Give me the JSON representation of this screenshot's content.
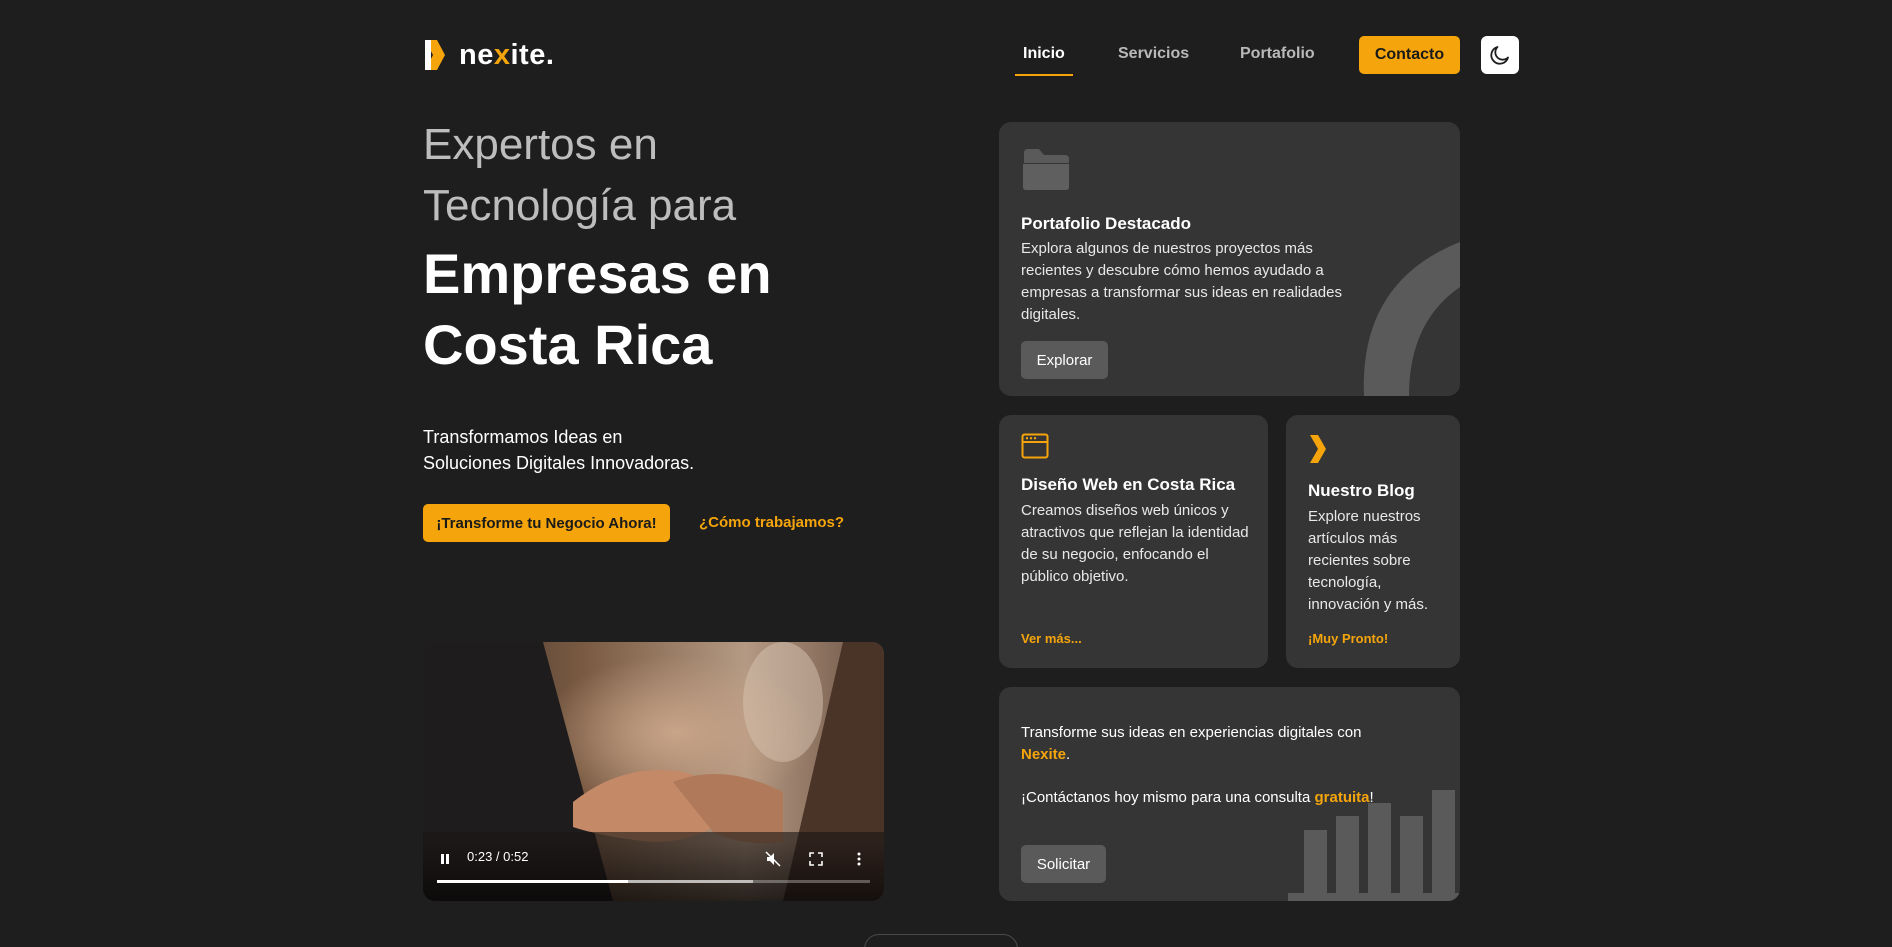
{
  "brand": {
    "name_prefix": "ne",
    "name_x": "x",
    "name_suffix": "ite.",
    "accent": "#f5a50b"
  },
  "nav": {
    "items": [
      {
        "label": "Inicio",
        "active": true
      },
      {
        "label": "Servicios",
        "active": false
      },
      {
        "label": "Portafolio",
        "active": false
      }
    ],
    "contact_label": "Contacto",
    "theme_icon": "moon-icon"
  },
  "hero": {
    "heading_line1": "Expertos en",
    "heading_line2": "Tecnología para",
    "heading_bold_line1": "Empresas en",
    "heading_bold_line2": "Costa Rica",
    "subtitle_line1": "Transformamos Ideas en",
    "subtitle_line2": "Soluciones Digitales Innovadoras.",
    "cta_primary": "¡Transforme tu Negocio Ahora!",
    "cta_secondary": "¿Cómo trabajamos?"
  },
  "video": {
    "time": "0:23 / 0:52",
    "played_fraction": 0.44,
    "buffered_fraction": 0.73,
    "state": "playing",
    "muted": true
  },
  "cards": {
    "portfolio": {
      "icon": "folder-icon",
      "title": "Portafolio Destacado",
      "text": "Explora algunos de nuestros proyectos más recientes y descubre cómo hemos ayudado a empresas a transformar sus ideas en realidades digitales.",
      "button": "Explorar"
    },
    "web": {
      "icon": "browser-window-icon",
      "title": "Diseño Web en Costa Rica",
      "text": "Creamos diseños web únicos y atractivos que reflejan la identidad de su negocio, enfocando el público objetivo.",
      "link": "Ver más..."
    },
    "blog": {
      "icon": "chevron-right-icon",
      "title": "Nuestro Blog",
      "text": "Explore nuestros artículos más recientes sobre tecnología, innovación y más.",
      "link": "¡Muy Pronto!"
    },
    "cta": {
      "text1": "Transforme sus ideas en experiencias digitales con",
      "brand": "Nexite",
      "text1_end": ".",
      "text2": "¡Contáctanos hoy mismo para una consulta",
      "accent_word": "gratuita",
      "text2_end": "!",
      "button": "Solicitar",
      "decoration": "bar-chart-icon"
    }
  }
}
